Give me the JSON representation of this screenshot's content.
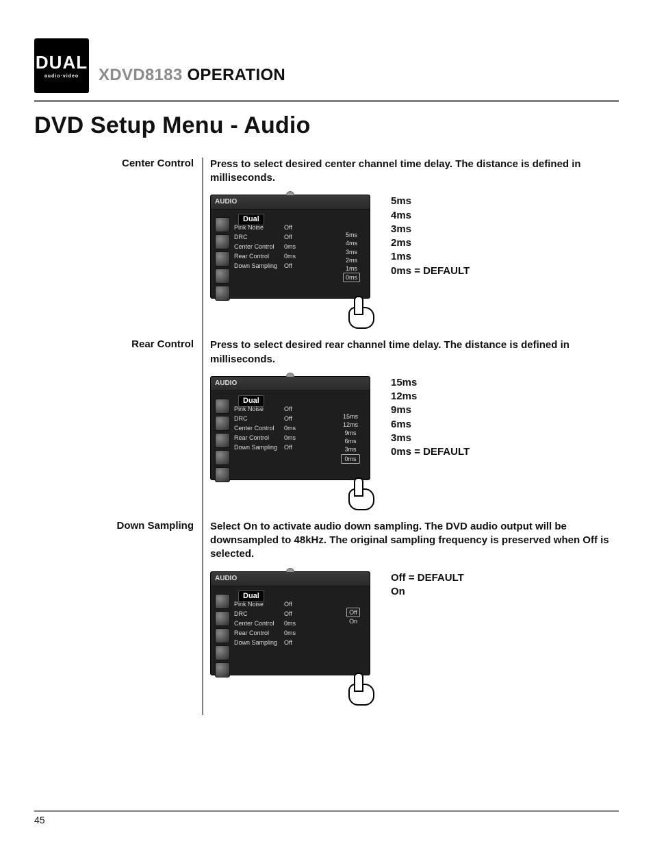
{
  "logo": {
    "top": "DUAL",
    "bottom": "audio·video"
  },
  "header": {
    "model": "XDVD8183",
    "operation": "OPERATION"
  },
  "title": "DVD Setup Menu - Audio",
  "page_number": "45",
  "shot_menu": {
    "tab": "AUDIO",
    "brand": "Dual",
    "rows": [
      {
        "k": "Pink Noise",
        "v": "Off"
      },
      {
        "k": "DRC",
        "v": "Off"
      },
      {
        "k": "Center Control",
        "v": "0ms"
      },
      {
        "k": "Rear Control",
        "v": "0ms"
      },
      {
        "k": "Down Sampling",
        "v": "Off"
      }
    ]
  },
  "sections": [
    {
      "id": "center",
      "label": "Center Control",
      "desc": "Press to select desired center channel time delay. The distance is defined in milliseconds.",
      "options": [
        "5ms",
        "4ms",
        "3ms",
        "2ms",
        "1ms",
        "0ms = DEFAULT"
      ],
      "sub": [
        "5ms",
        "4ms",
        "3ms",
        "2ms",
        "1ms",
        "0ms"
      ],
      "sel_index": 5
    },
    {
      "id": "rear",
      "label": "Rear Control",
      "desc": "Press to select desired rear channel time delay. The distance is defined in milliseconds.",
      "options": [
        "15ms",
        "12ms",
        "9ms",
        "6ms",
        "3ms",
        "0ms = DEFAULT"
      ],
      "sub": [
        "15ms",
        "12ms",
        "9ms",
        "6ms",
        "3ms",
        "0ms"
      ],
      "sel_index": 5
    },
    {
      "id": "down",
      "label": "Down Sampling",
      "desc": "Select On to activate audio down sampling. The DVD audio output will be downsampled to 48kHz. The original sampling frequency is preserved when Off is selected.",
      "options": [
        "Off = DEFAULT",
        "On"
      ],
      "sub": [
        "Off",
        "On"
      ],
      "sel_index": 0
    }
  ]
}
